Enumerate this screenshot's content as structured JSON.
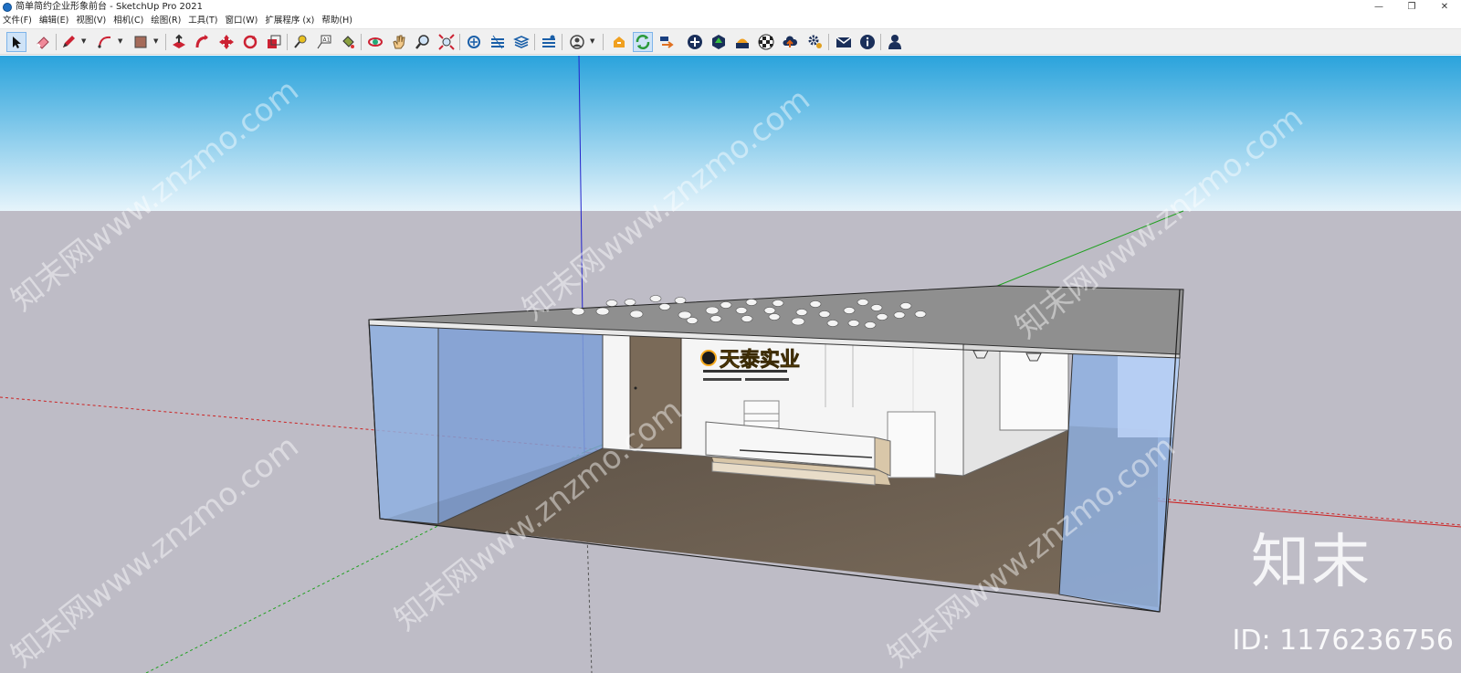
{
  "window": {
    "title": "简单简约企业形象前台 - SketchUp Pro 2021",
    "minimize_glyph": "—",
    "restore_glyph": "❐",
    "close_glyph": "✕"
  },
  "menu": {
    "items": [
      {
        "label": "文件(F)"
      },
      {
        "label": "编辑(E)"
      },
      {
        "label": "视图(V)"
      },
      {
        "label": "相机(C)"
      },
      {
        "label": "绘图(R)"
      },
      {
        "label": "工具(T)"
      },
      {
        "label": "窗口(W)"
      },
      {
        "label": "扩展程序 (x)"
      },
      {
        "label": "帮助(H)"
      }
    ]
  },
  "toolbar": {
    "tools": [
      "select-tool-icon",
      "eraser-tool-icon",
      "pencil-tool-icon",
      "arc-tool-icon",
      "rectangle-tool-icon",
      "push-pull-icon",
      "follow-me-icon",
      "move-icon",
      "rotate-icon",
      "scale-icon",
      "tape-measure-icon",
      "text-icon",
      "paint-bucket-icon",
      "orbit-icon",
      "pan-icon",
      "zoom-icon",
      "zoom-extents-icon",
      "warehouse-icon",
      "extension-warehouse-icon",
      "layout-icon",
      "extension-manager-icon",
      "account-icon",
      "plugin-1-icon",
      "plugin-refresh-icon",
      "plugin-3-icon",
      "add-location-icon",
      "plugin-tree-icon",
      "plugin-shade-icon",
      "plugin-checker-icon",
      "cloud-upload-icon",
      "settings-icon",
      "mail-icon",
      "info-icon",
      "user-icon"
    ]
  },
  "scene": {
    "sign_text": "天泰实业",
    "colors": {
      "sky_top": "#2aa3dc",
      "sky_bottom": "#e6f4fb",
      "ground": "#bebcc6",
      "wall_front": "#f5f5f5",
      "ceiling": "#8f8f8f",
      "glass": "#8fb0e0",
      "floor": "#6e6152",
      "door": "#7a6a58",
      "accent_sign": "#f4a81d",
      "axis_red": "#cc2222",
      "axis_green": "#20a020",
      "axis_blue": "#2222cc"
    }
  },
  "watermark": {
    "logo": "知末",
    "id": "ID: 1176236756",
    "site": "知末网www.znzmo.com"
  }
}
